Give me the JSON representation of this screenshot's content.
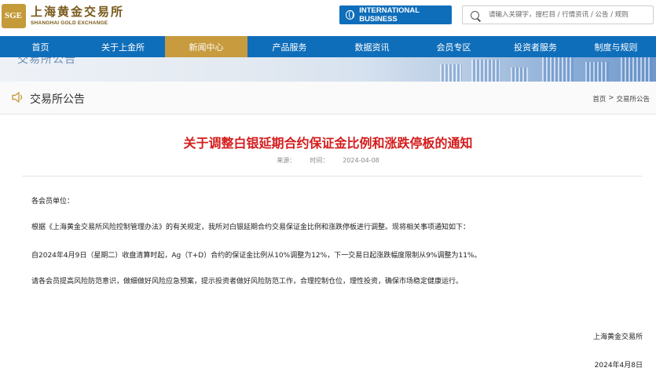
{
  "header": {
    "logo_mark": "SGE",
    "logo_cn": "上海黄金交易所",
    "logo_en": "SHANGHAI GOLD EXCHANGE",
    "intl_label": "INTERNATIONAL BUSINESS",
    "search_placeholder": "请输入关键字，搜栏目 / 行情资讯 / 公告 / 规则"
  },
  "nav": {
    "items": [
      {
        "label": "首页"
      },
      {
        "label": "关于上金所"
      },
      {
        "label": "新闻中心"
      },
      {
        "label": "产品服务"
      },
      {
        "label": "数据资讯"
      },
      {
        "label": "会员专区"
      },
      {
        "label": "投资者服务"
      },
      {
        "label": "制度与规则"
      }
    ],
    "active_index": 2
  },
  "banner": {
    "text": "交易所公告"
  },
  "page": {
    "title": "交易所公告",
    "breadcrumb": {
      "home": "首页",
      "sep": ">",
      "current": "交易所公告"
    }
  },
  "article": {
    "title": "关于调整白银延期合约保证金比例和涨跌停板的通知",
    "source_label": "来源：",
    "time_label": "时间：",
    "date": "2024-04-08",
    "greeting": "各会员单位：",
    "paragraphs": [
      "根据《上海黄金交易所风险控制管理办法》的有关规定，我所对白银延期合约交易保证金比例和涨跌停板进行调整。现将相关事项通知如下：",
      "自2024年4月9日（星期二）收盘清算时起，Ag（T+D）合约的保证金比例从10%调整为12%，下一交易日起涨跌幅度限制从9%调整为11%。",
      "请各会员提高风险防范意识，做细做好风险应急预案，提示投资者做好风险防范工作，合理控制仓位，理性投资，确保市场稳定健康运行。"
    ],
    "signature": "上海黄金交易所",
    "sign_date": "2024年4月8日"
  },
  "colors": {
    "nav_blue": "#0f6eba",
    "active_gold": "#c79b3e",
    "title_red": "#d41c1c"
  }
}
